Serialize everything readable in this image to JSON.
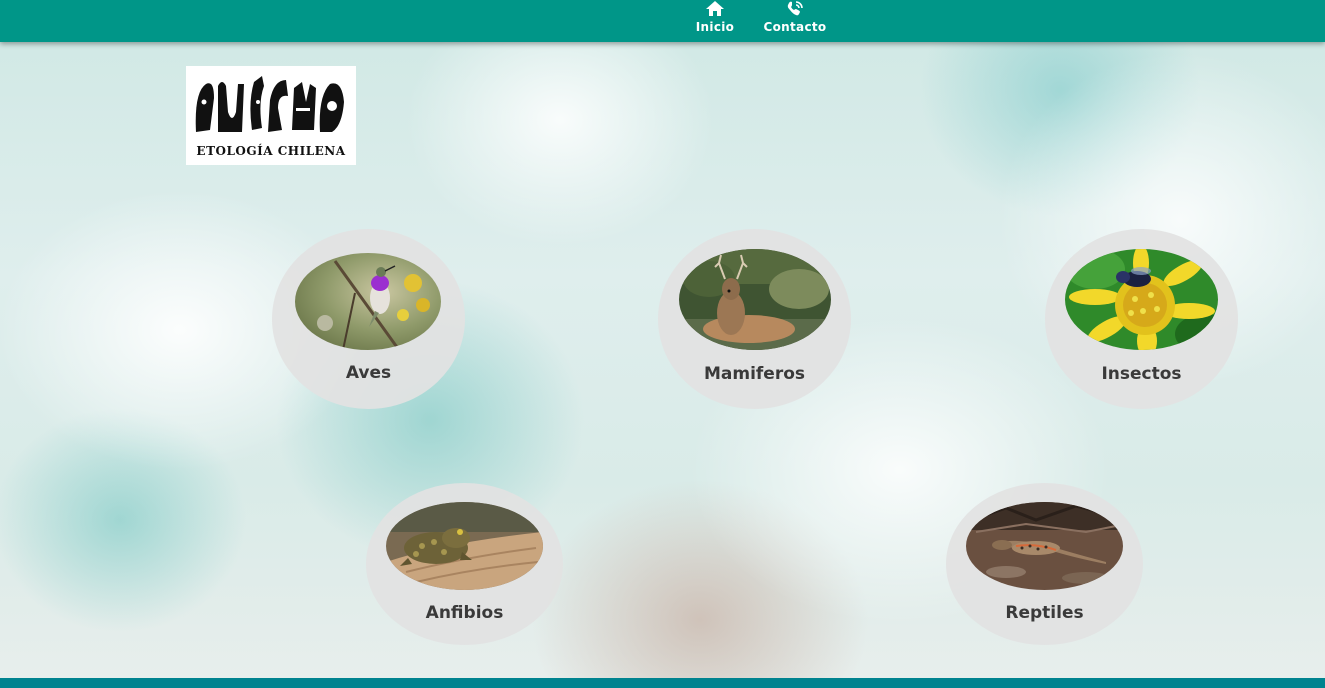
{
  "nav": {
    "items": [
      {
        "label": "Inicio",
        "icon": "home-icon"
      },
      {
        "label": "Contacto",
        "icon": "contact-icon"
      }
    ]
  },
  "logo": {
    "text": "ETOLOGÍA CHILENA"
  },
  "categories": [
    {
      "label": "Aves",
      "image": "hummingbird-photo"
    },
    {
      "label": "Mamiferos",
      "image": "deer-photo"
    },
    {
      "label": "Insectos",
      "image": "bee-on-flower-photo"
    },
    {
      "label": "Anfibios",
      "image": "toad-photo"
    },
    {
      "label": "Reptiles",
      "image": "lizard-photo"
    }
  ],
  "colors": {
    "navbar": "#009688",
    "footer": "#00838f",
    "card_bg": "#e2e2e2",
    "label_text": "#3a3a3a"
  }
}
